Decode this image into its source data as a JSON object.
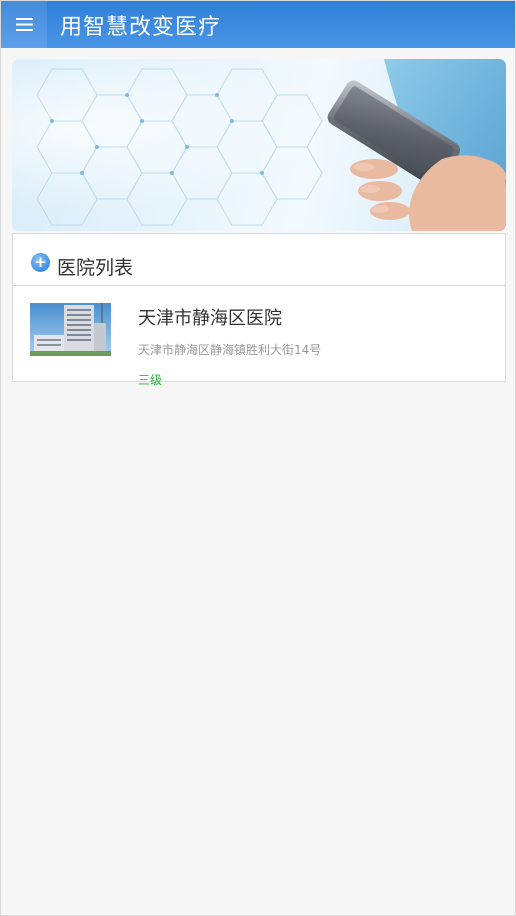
{
  "header": {
    "title": "用智慧改变医疗",
    "menu_icon": "hamburger-menu-icon"
  },
  "banner": {
    "image": "hand-holding-smartphone-hexagon-background"
  },
  "hospital_list": {
    "title": "医院列表",
    "header_icon": "plus-circle-icon",
    "items": [
      {
        "name": "天津市静海区医院",
        "address": "天津市静海区静海镇胜利大街14号",
        "level": "三级",
        "thumbnail": "hospital-building-photo"
      }
    ]
  },
  "colors": {
    "header_bar": "#3a87df",
    "level_text": "#27b83b",
    "page_background": "#f6f6f6"
  }
}
